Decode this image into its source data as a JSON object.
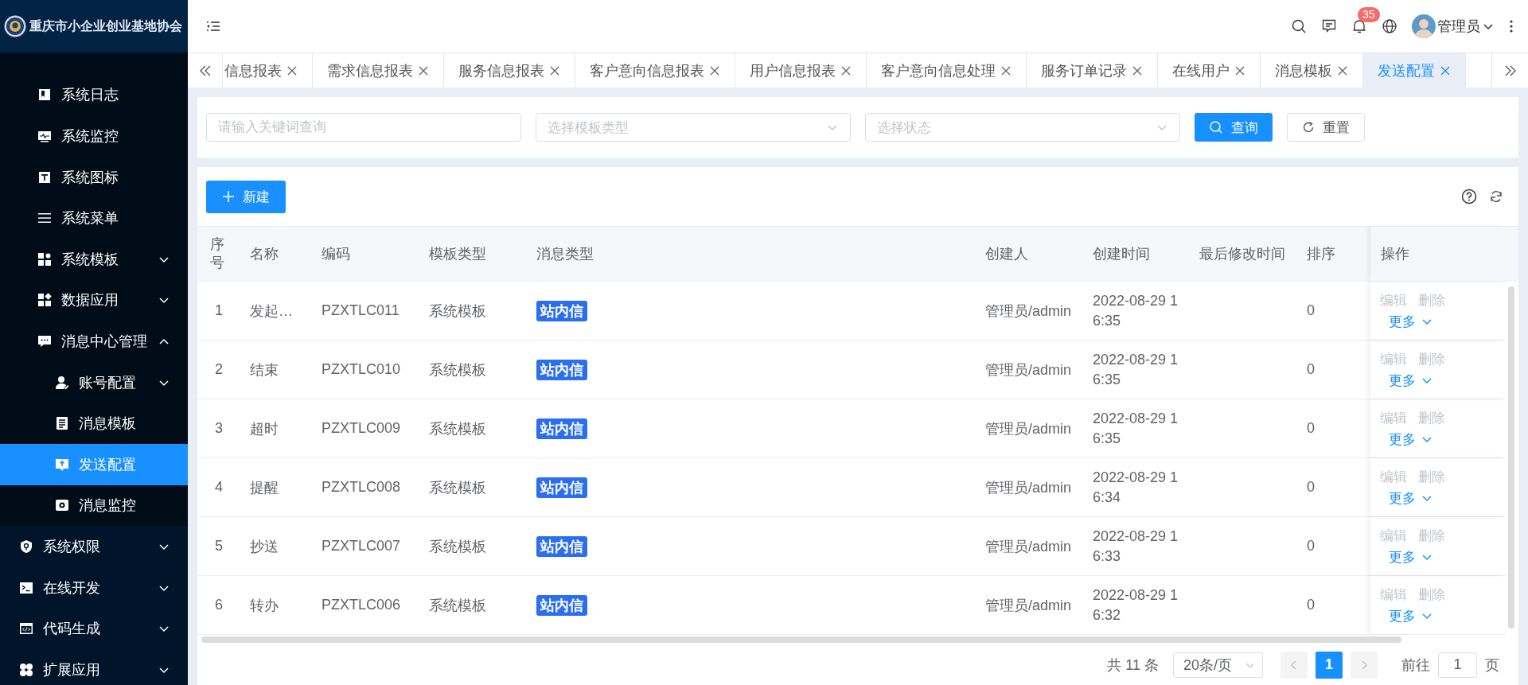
{
  "app": {
    "title": "重庆市小企业创业基地协会"
  },
  "header": {
    "notifications": "35",
    "user": "管理员"
  },
  "sidebar": {
    "submenu": [
      {
        "label": "系统日志",
        "kind": "link",
        "selected": false
      },
      {
        "label": "系统监控",
        "kind": "link",
        "selected": false
      },
      {
        "label": "系统图标",
        "kind": "link",
        "selected": false
      },
      {
        "label": "系统菜单",
        "kind": "link",
        "selected": false
      },
      {
        "label": "系统模板",
        "kind": "group",
        "expanded": false,
        "selected": false
      },
      {
        "label": "数据应用",
        "kind": "group",
        "expanded": false,
        "selected": false
      },
      {
        "label": "消息中心管理",
        "kind": "group",
        "expanded": true,
        "selected": false,
        "children": [
          {
            "label": "账号配置",
            "kind": "group",
            "expanded": false,
            "selected": false
          },
          {
            "label": "消息模板",
            "kind": "link",
            "selected": false
          },
          {
            "label": "发送配置",
            "kind": "link",
            "selected": true
          },
          {
            "label": "消息监控",
            "kind": "link",
            "selected": false
          }
        ]
      }
    ],
    "items": [
      {
        "label": "系统权限",
        "kind": "group",
        "expanded": false,
        "selected": false
      },
      {
        "label": "在线开发",
        "kind": "group",
        "expanded": false,
        "selected": false
      },
      {
        "label": "代码生成",
        "kind": "group",
        "expanded": false,
        "selected": false
      },
      {
        "label": "扩展应用",
        "kind": "group",
        "expanded": false,
        "selected": false
      }
    ]
  },
  "tabs": [
    {
      "label": "信息报表",
      "selected": false
    },
    {
      "label": "需求信息报表",
      "selected": false
    },
    {
      "label": "服务信息报表",
      "selected": false
    },
    {
      "label": "客户意向信息报表",
      "selected": false
    },
    {
      "label": "用户信息报表",
      "selected": false
    },
    {
      "label": "客户意向信息处理",
      "selected": false
    },
    {
      "label": "服务订单记录",
      "selected": false
    },
    {
      "label": "在线用户",
      "selected": false
    },
    {
      "label": "消息模板",
      "selected": false
    },
    {
      "label": "发送配置",
      "selected": true
    }
  ],
  "search": {
    "keyword_placeholder": "请输入关键词查询",
    "template_type_placeholder": "选择模板类型",
    "status_placeholder": "选择状态",
    "query_button": "查询",
    "reset_button": "重置"
  },
  "toolbar": {
    "new_button": "新建"
  },
  "table": {
    "columns": [
      "序号",
      "名称",
      "编码",
      "模板类型",
      "消息类型",
      "创建人",
      "创建时间",
      "最后修改时间",
      "排序",
      "操作"
    ],
    "rows": [
      {
        "index": "1",
        "name": "发起…",
        "code": "PZXTLC011",
        "template_type": "系统模板",
        "message_type": "站内信",
        "creator": "管理员/admin",
        "created": "2022-08-29 16:35",
        "sort": "0",
        "actions": [
          {
            "label": "编辑",
            "disabled": true
          },
          {
            "label": "删除",
            "disabled": true
          }
        ],
        "more": "更多"
      },
      {
        "index": "2",
        "name": "结束",
        "code": "PZXTLC010",
        "template_type": "系统模板",
        "message_type": "站内信",
        "creator": "管理员/admin",
        "created": "2022-08-29 16:35",
        "sort": "0",
        "actions": [
          {
            "label": "编辑",
            "disabled": true
          },
          {
            "label": "删除",
            "disabled": true
          }
        ],
        "more": "更多"
      },
      {
        "index": "3",
        "name": "超时",
        "code": "PZXTLC009",
        "template_type": "系统模板",
        "message_type": "站内信",
        "creator": "管理员/admin",
        "created": "2022-08-29 16:35",
        "sort": "0",
        "actions": [
          {
            "label": "编辑",
            "disabled": true
          },
          {
            "label": "删除",
            "disabled": true
          }
        ],
        "more": "更多"
      },
      {
        "index": "4",
        "name": "提醒",
        "code": "PZXTLC008",
        "template_type": "系统模板",
        "message_type": "站内信",
        "creator": "管理员/admin",
        "created": "2022-08-29 16:34",
        "sort": "0",
        "actions": [
          {
            "label": "编辑",
            "disabled": true
          },
          {
            "label": "删除",
            "disabled": true
          }
        ],
        "more": "更多"
      },
      {
        "index": "5",
        "name": "抄送",
        "code": "PZXTLC007",
        "template_type": "系统模板",
        "message_type": "站内信",
        "creator": "管理员/admin",
        "created": "2022-08-29 16:33",
        "sort": "0",
        "actions": [
          {
            "label": "编辑",
            "disabled": true
          },
          {
            "label": "删除",
            "disabled": true
          }
        ],
        "more": "更多"
      },
      {
        "index": "6",
        "name": "转办",
        "code": "PZXTLC006",
        "template_type": "系统模板",
        "message_type": "站内信",
        "creator": "管理员/admin",
        "created": "2022-08-29 16:32",
        "sort": "0",
        "actions": [
          {
            "label": "编辑",
            "disabled": true
          },
          {
            "label": "删除",
            "disabled": true
          }
        ],
        "more": "更多"
      }
    ]
  },
  "pagination": {
    "total": "共 11 条",
    "page_size": "20条/页",
    "pages": [
      {
        "label": "1",
        "selected": true
      }
    ],
    "goto_label": "前往",
    "goto_value": "1",
    "goto_suffix": "页"
  }
}
